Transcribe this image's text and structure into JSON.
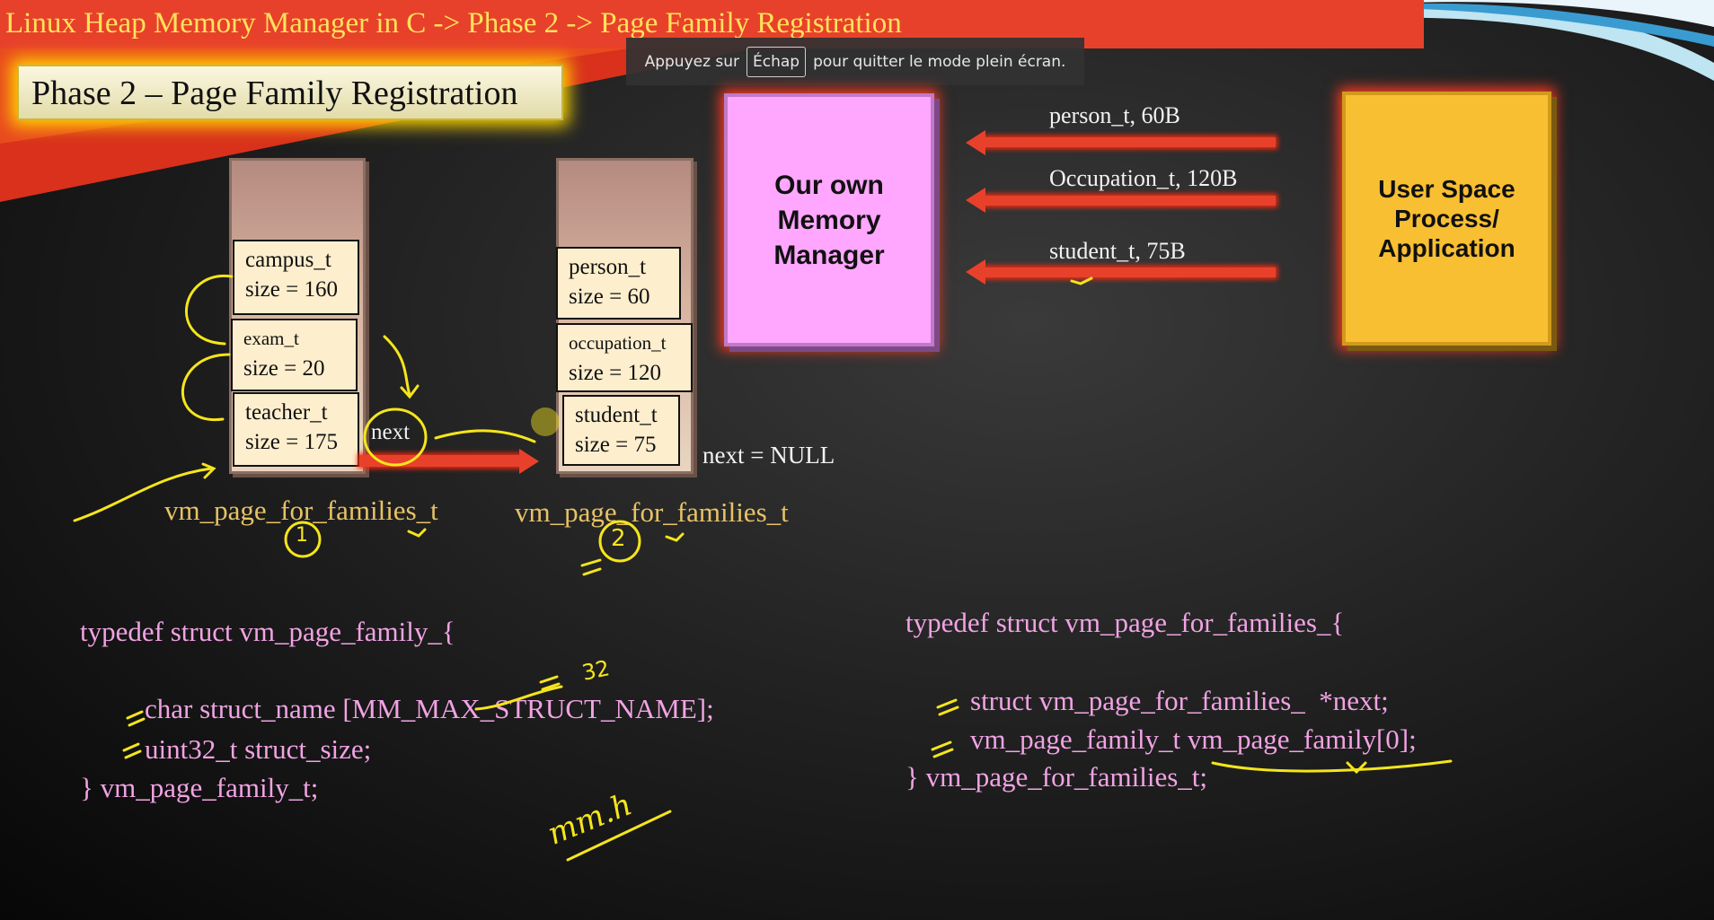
{
  "header": {
    "title": "Linux Heap Memory Manager in C -> Phase 2 -> Page Family Registration"
  },
  "fullscreen_notice": {
    "before": "Appuyez sur",
    "key": "Échap",
    "after": "pour quitter le mode plein écran."
  },
  "slide": {
    "heading": "Phase 2 – Page Family Registration",
    "page1": {
      "families": [
        {
          "name": "campus_t",
          "size": "size = 160"
        },
        {
          "name": "exam_t",
          "size": "size = 20"
        },
        {
          "name": "teacher_t",
          "size": "size = 175"
        }
      ],
      "next_label": "next",
      "caption": "vm_page_for_families_t",
      "annotation": "1"
    },
    "page2": {
      "families": [
        {
          "name": "person_t",
          "size": "size = 60"
        },
        {
          "name": "occupation_t",
          "size": "size = 120"
        },
        {
          "name": "student_t",
          "size": "size = 75"
        }
      ],
      "next_null_label": "next = NULL",
      "caption": "vm_page_for_families_t",
      "annotation": "2"
    },
    "memory_manager": "Our own Memory Manager",
    "user_space": "User Space Process/ Application",
    "requests": [
      "person_t, 60B",
      "Occupation_t, 120B",
      "student_t, 75B"
    ],
    "code_left": {
      "line1": "typedef struct vm_page_family_{",
      "line2": "char struct_name [MM_MAX_STRUCT_NAME];",
      "line3": "uint32_t struct_size;",
      "line4": "} vm_page_family_t;"
    },
    "code_right": {
      "line1": "typedef struct vm_page_for_families_{",
      "line2": "struct vm_page_for_families_  *next;",
      "line3": "vm_page_family_t vm_page_family[0];",
      "line4": "} vm_page_for_families_t;"
    },
    "annotations": {
      "max_name": "32",
      "file": "mm.h"
    }
  },
  "colors": {
    "title_bar": "#e8412b",
    "title_text": "#ffe35a",
    "code": "#f1a3e4",
    "memory_manager": "#ffa6ff",
    "user_space": "#f8bf32",
    "annotation": "#f5e51c"
  }
}
